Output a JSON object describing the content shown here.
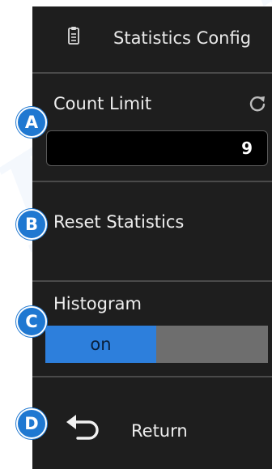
{
  "colors": {
    "panel_bg": "#1e1e1e",
    "accent": "#2d7fdc",
    "callout": "#1f78d1",
    "toggle_off": "#6e6e6e"
  },
  "header": {
    "icon": "clipboard-icon",
    "title": "Statistics Config"
  },
  "count_limit": {
    "label": "Count Limit",
    "value": "9",
    "icon": "refresh-icon"
  },
  "reset": {
    "label": "Reset Statistics"
  },
  "histogram": {
    "label": "Histogram",
    "on_label": "on",
    "state": "on"
  },
  "return": {
    "icon": "return-arrow-icon",
    "label": "Return"
  },
  "callouts": {
    "a": "A",
    "b": "B",
    "c": "C",
    "d": "D"
  },
  "watermark": "Rigol"
}
